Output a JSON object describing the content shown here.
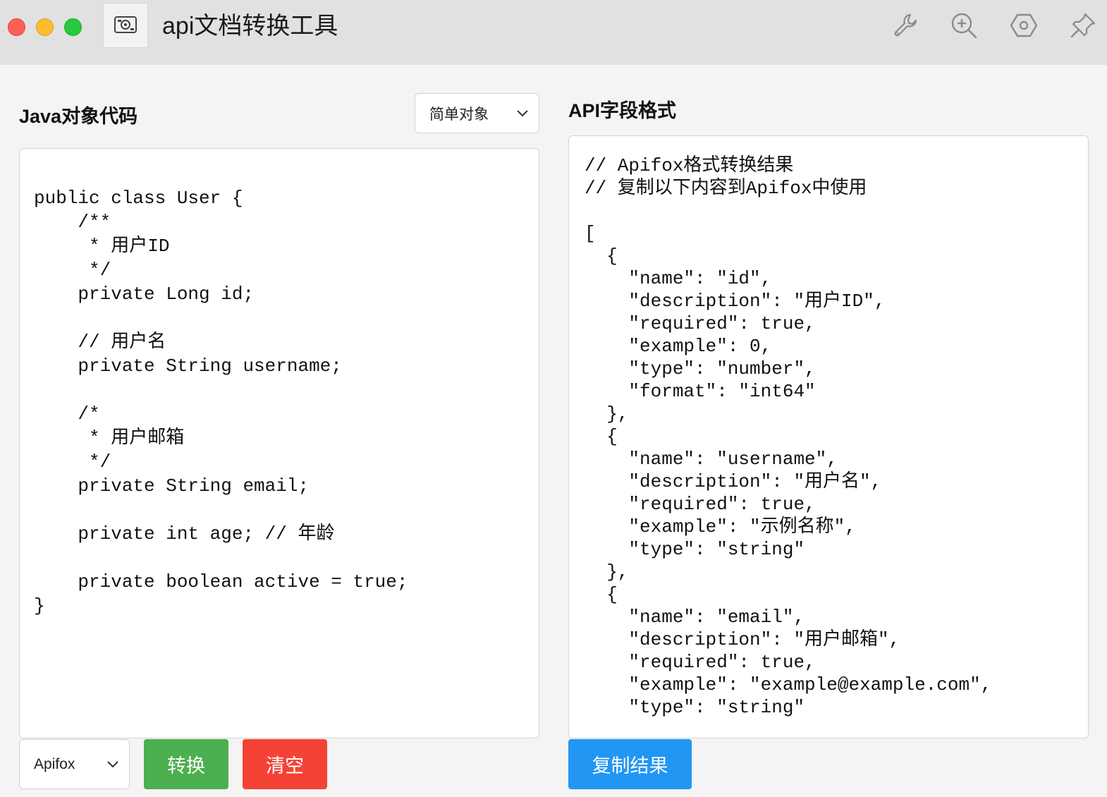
{
  "window": {
    "title": "api文档转换工具",
    "app_icon": "tool-icon",
    "toolbar_icons": [
      "wrench-icon",
      "zoom-in-icon",
      "hexagon-icon",
      "pin-icon"
    ]
  },
  "left_panel": {
    "title": "Java对象代码",
    "object_type_select": {
      "value": "简单对象"
    },
    "code_lines": [
      "",
      "public class User {",
      "    /**",
      "     * 用户ID",
      "     */",
      "    private Long id;",
      "",
      "    // 用户名",
      "    private String username;",
      "",
      "    /*",
      "     * 用户邮箱",
      "     */",
      "    private String email;",
      "",
      "    private int age; // 年龄",
      "",
      "    private boolean active = true;",
      "}"
    ],
    "format_select": {
      "value": "Apifox"
    },
    "convert_button": "转换",
    "clear_button": "清空"
  },
  "right_panel": {
    "title": "API字段格式",
    "result_lines": [
      "// Apifox格式转换结果",
      "// 复制以下内容到Apifox中使用",
      "",
      "[",
      "  {",
      "    \"name\": \"id\",",
      "    \"description\": \"用户ID\",",
      "    \"required\": true,",
      "    \"example\": 0,",
      "    \"type\": \"number\",",
      "    \"format\": \"int64\"",
      "  },",
      "  {",
      "    \"name\": \"username\",",
      "    \"description\": \"用户名\",",
      "    \"required\": true,",
      "    \"example\": \"示例名称\",",
      "    \"type\": \"string\"",
      "  },",
      "  {",
      "    \"name\": \"email\",",
      "    \"description\": \"用户邮箱\",",
      "    \"required\": true,",
      "    \"example\": \"example@example.com\",",
      "    \"type\": \"string\""
    ],
    "copy_button": "复制结果"
  },
  "colors": {
    "convert": "#4caf50",
    "clear": "#f44336",
    "copy": "#2196f3"
  }
}
